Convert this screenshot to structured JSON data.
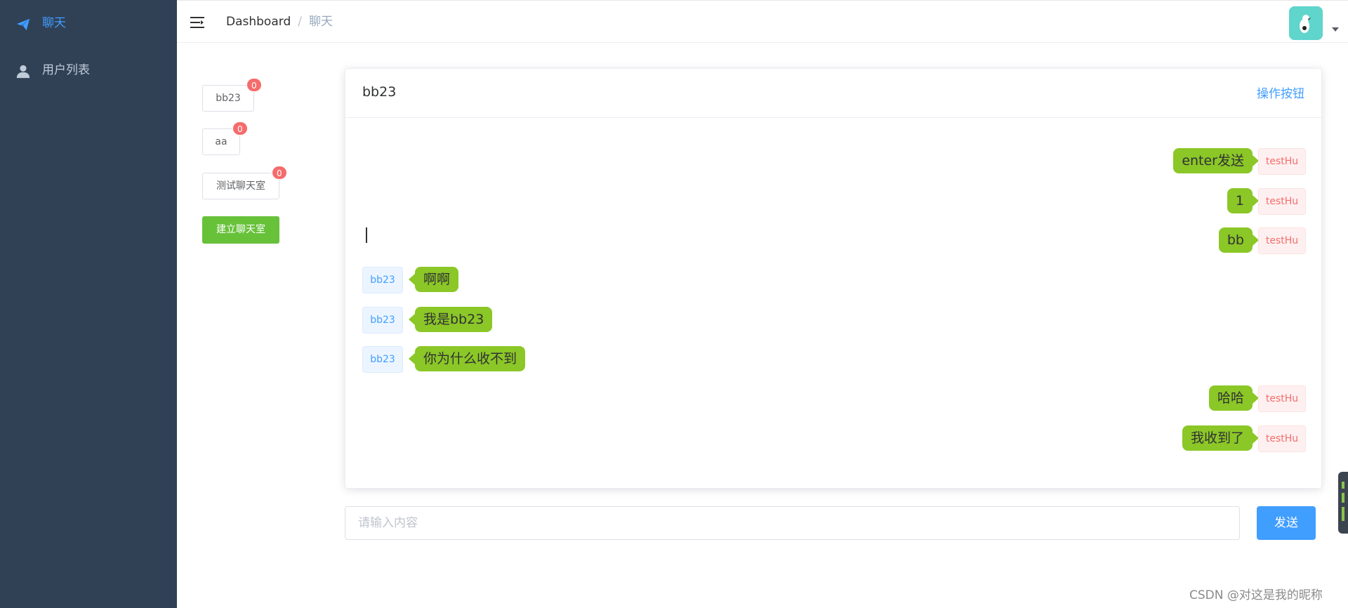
{
  "sidebar": {
    "items": [
      {
        "label": "聊天",
        "icon": "paper-plane-icon",
        "active": true
      },
      {
        "label": "用户列表",
        "icon": "user-icon",
        "active": false
      }
    ]
  },
  "navbar": {
    "breadcrumb": {
      "home": "Dashboard",
      "separator": "/",
      "current": "聊天"
    },
    "avatar_icon": "avatar-image"
  },
  "rooms": [
    {
      "name": "bb23",
      "unread": "0"
    },
    {
      "name": "aa",
      "unread": "0"
    },
    {
      "name": "测试聊天室",
      "unread": "0"
    }
  ],
  "create_room_label": "建立聊天室",
  "chat": {
    "title": "bb23",
    "action_label": "操作按钮",
    "messages": [
      {
        "from": "testHu",
        "side": "right",
        "text": "enter发送"
      },
      {
        "from": "testHu",
        "side": "right",
        "text": "1"
      },
      {
        "from": "testHu",
        "side": "right",
        "text": "bb"
      },
      {
        "from": "bb23",
        "side": "left",
        "text": "啊啊"
      },
      {
        "from": "bb23",
        "side": "left",
        "text": "我是bb23"
      },
      {
        "from": "bb23",
        "side": "left",
        "text": "你为什么收不到"
      },
      {
        "from": "testHu",
        "side": "right",
        "text": "哈哈"
      },
      {
        "from": "testHu",
        "side": "right",
        "text": "我收到了"
      }
    ]
  },
  "input": {
    "placeholder": "请输入内容",
    "value": ""
  },
  "send_label": "发送",
  "watermark": "CSDN @对这是我的昵称",
  "colors": {
    "sidebar_bg": "#304156",
    "accent": "#409eff",
    "bubble": "#8bc727",
    "success": "#67c23a",
    "danger": "#f56c6c"
  }
}
